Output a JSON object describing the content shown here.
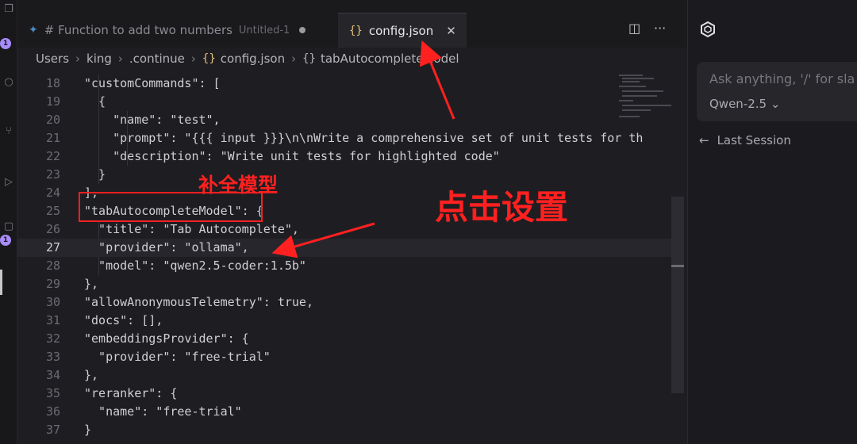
{
  "tabs": [
    {
      "label": "# Function to add two numbers",
      "sublabel": "Untitled-1"
    },
    {
      "label": "config.json"
    }
  ],
  "breadcrumb": [
    "Users",
    "king",
    ".continue",
    "config.json",
    "tabAutocompleteModel"
  ],
  "badges": [
    "1",
    "1"
  ],
  "code": [
    {
      "n": "18",
      "t": "\"customCommands\": ["
    },
    {
      "n": "19",
      "t": "  {"
    },
    {
      "n": "20",
      "t": "    \"name\": \"test\","
    },
    {
      "n": "21",
      "t": "    \"prompt\": \"{{{ input }}}\\n\\nWrite a comprehensive set of unit tests for th"
    },
    {
      "n": "22",
      "t": "    \"description\": \"Write unit tests for highlighted code\""
    },
    {
      "n": "23",
      "t": "  }"
    },
    {
      "n": "24",
      "t": "],"
    },
    {
      "n": "25",
      "t": "\"tabAutocompleteModel\": {"
    },
    {
      "n": "26",
      "t": "  \"title\": \"Tab Autocomplete\","
    },
    {
      "n": "27",
      "t": "  \"provider\": \"ollama\","
    },
    {
      "n": "28",
      "t": "  \"model\": \"qwen2.5-coder:1.5b\""
    },
    {
      "n": "29",
      "t": "},"
    },
    {
      "n": "30",
      "t": "\"allowAnonymousTelemetry\": true,"
    },
    {
      "n": "31",
      "t": "\"docs\": [],"
    },
    {
      "n": "32",
      "t": "\"embeddingsProvider\": {"
    },
    {
      "n": "33",
      "t": "  \"provider\": \"free-trial\""
    },
    {
      "n": "34",
      "t": "},"
    },
    {
      "n": "35",
      "t": "\"reranker\": {"
    },
    {
      "n": "36",
      "t": "  \"name\": \"free-trial\""
    },
    {
      "n": "37",
      "t": "}"
    }
  ],
  "annotations": {
    "label_1": "补全模型",
    "label_2": "点击设置"
  },
  "chat": {
    "placeholder": "Ask anything, '/' for sla",
    "model": "Qwen-2.5 ⌄",
    "last_session": "Last Session"
  },
  "colors": {
    "accent": "#a78bfa",
    "annotation": "#ff2020"
  }
}
